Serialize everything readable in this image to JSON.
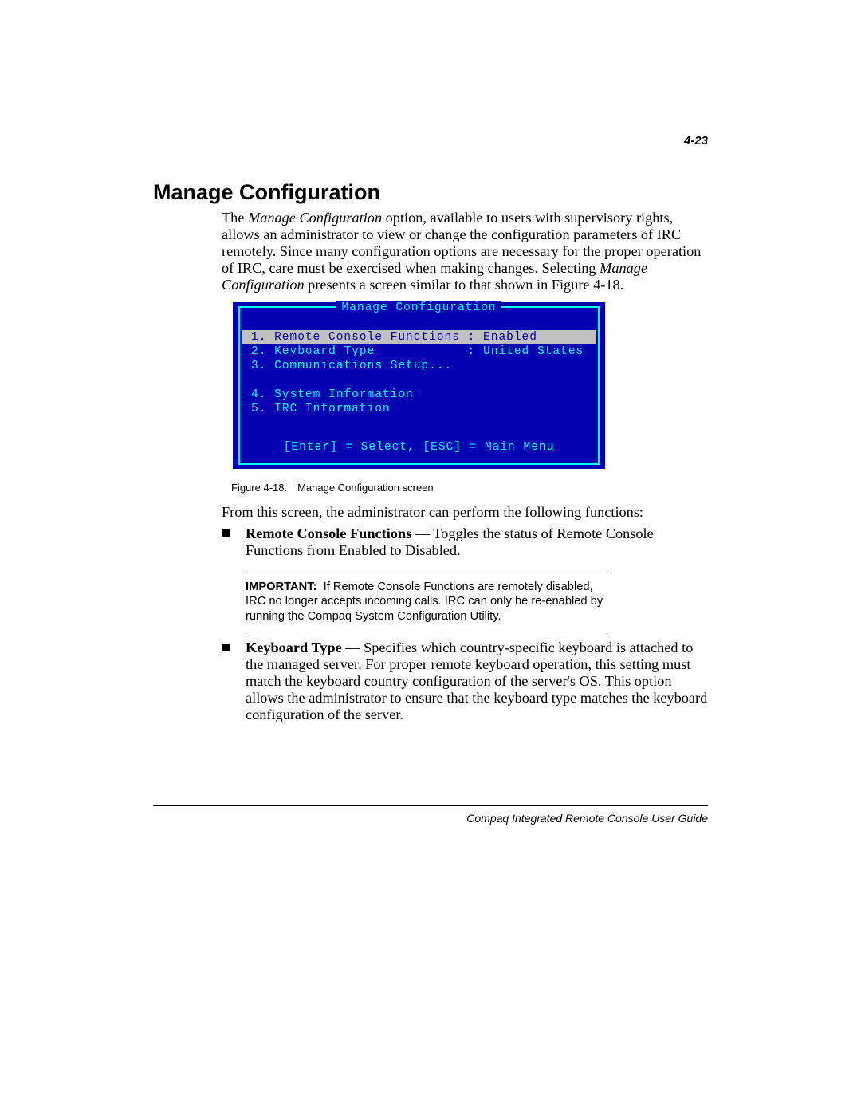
{
  "page_number": "4-23",
  "heading": "Manage Configuration",
  "intro": {
    "pre": "The ",
    "em1": "Manage Configuration",
    "mid": " option, available to users with supervisory rights, allows an administrator to view or change the configuration parameters of IRC remotely. Since many configuration options are necessary for the proper operation of IRC, care must be exercised when making changes. Selecting ",
    "em2": "Manage Configuration",
    "post": " presents a screen similar to that shown in Figure 4-18."
  },
  "console": {
    "title": " Manage Configuration ",
    "items": [
      {
        "text": "1. Remote Console Functions : Enabled",
        "selected": true
      },
      {
        "text": "2. Keyboard Type            : United States",
        "selected": false
      },
      {
        "text": "3. Communications Setup...",
        "selected": false
      }
    ],
    "items2": [
      {
        "text": "4. System Information",
        "selected": false
      },
      {
        "text": "5. IRC Information",
        "selected": false
      }
    ],
    "footer": "[Enter] = Select, [ESC] = Main Menu"
  },
  "figure_caption": "Figure 4-18. Manage Configuration screen",
  "followup": "From this screen, the administrator can perform the following functions:",
  "bullets": [
    {
      "bold": "Remote Console Functions",
      "text": " — Toggles the status of Remote Console Functions from Enabled to Disabled."
    },
    {
      "bold": "Keyboard Type",
      "text": " — Specifies which country-specific keyboard is attached to the managed server. For proper remote keyboard operation, this setting must match the keyboard country configuration of the server's OS. This option allows the administrator to ensure that the keyboard type matches the keyboard configuration of the server."
    }
  ],
  "important": {
    "label": "IMPORTANT:",
    "text": "  If Remote Console Functions are remotely disabled, IRC no longer accepts incoming calls. IRC can only be re-enabled by running the Compaq System Configuration Utility."
  },
  "footer": "Compaq Integrated Remote Console User Guide"
}
